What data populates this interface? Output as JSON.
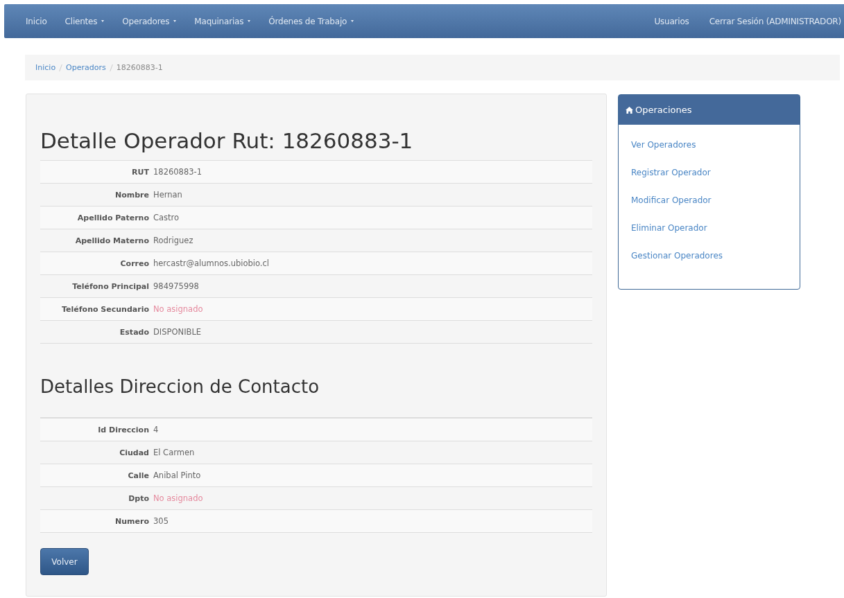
{
  "navbar": {
    "left": [
      {
        "label": "Inicio",
        "dropdown": false
      },
      {
        "label": "Clientes",
        "dropdown": true
      },
      {
        "label": "Operadores",
        "dropdown": true
      },
      {
        "label": "Maquinarias",
        "dropdown": true
      },
      {
        "label": "Órdenes de Trabajo",
        "dropdown": true
      }
    ],
    "right": [
      {
        "label": "Usuarios",
        "dropdown": false
      },
      {
        "label": "Cerrar Sesión (ADMINISTRADOR)",
        "dropdown": false
      }
    ]
  },
  "breadcrumb": [
    {
      "label": "Inicio",
      "link": true
    },
    {
      "label": "Operadors",
      "link": true
    },
    {
      "label": "18260883-1",
      "link": false
    }
  ],
  "main": {
    "title": "Detalle Operador Rut: 18260883-1",
    "details": [
      {
        "label": "RUT",
        "value": "18260883-1",
        "unassigned": false
      },
      {
        "label": "Nombre",
        "value": "Hernan",
        "unassigned": false
      },
      {
        "label": "Apellido Paterno",
        "value": "Castro",
        "unassigned": false
      },
      {
        "label": "Apellido Materno",
        "value": "Rodriguez",
        "unassigned": false
      },
      {
        "label": "Correo",
        "value": "hercastr@alumnos.ubiobio.cl",
        "unassigned": false
      },
      {
        "label": "Teléfono Principal",
        "value": "984975998",
        "unassigned": false
      },
      {
        "label": "Teléfono Secundario",
        "value": "No asignado",
        "unassigned": true
      },
      {
        "label": "Estado",
        "value": "DISPONIBLE",
        "unassigned": false
      }
    ],
    "address_title": "Detalles Direccion de Contacto",
    "address": [
      {
        "label": "Id Direccion",
        "value": "4",
        "unassigned": false
      },
      {
        "label": "Ciudad",
        "value": "El Carmen",
        "unassigned": false
      },
      {
        "label": "Calle",
        "value": "Anibal Pinto",
        "unassigned": false
      },
      {
        "label": "Dpto",
        "value": "No asignado",
        "unassigned": true
      },
      {
        "label": "Numero",
        "value": "305",
        "unassigned": false
      }
    ],
    "button": "Volver"
  },
  "sidebar": {
    "title": "Operaciones",
    "links": [
      "Ver Operadores",
      "Registrar Operador",
      "Modificar Operador",
      "Eliminar Operador",
      "Gestionar Operadores"
    ]
  }
}
